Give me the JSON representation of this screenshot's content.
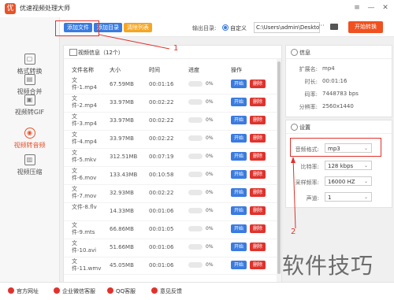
{
  "app": {
    "title": "优速视频处理大师",
    "logo_char": "优"
  },
  "window_controls": {
    "menu": "≡",
    "minimize": "—",
    "close": "✕"
  },
  "sidebar": {
    "items": [
      {
        "label": "格式转换",
        "icon": "convert-icon",
        "glyph": "▢"
      },
      {
        "label": "视频合并",
        "icon": "merge-icon",
        "glyph": "▤"
      },
      {
        "label": "视频转GIF",
        "icon": "gif-icon",
        "glyph": "▣"
      },
      {
        "label": "视频转音频",
        "icon": "audio-icon",
        "glyph": "◉"
      },
      {
        "label": "视频压缩",
        "icon": "compress-icon",
        "glyph": "▥"
      }
    ]
  },
  "toolbar": {
    "add_file": "添加文件",
    "add_folder": "添加目录",
    "clear_list": "清除列表",
    "output_label": "输出目录:",
    "custom_label": "自定义",
    "output_path": "C:\\Users\\admin\\Deskto",
    "dots": "···",
    "start": "开始转换"
  },
  "list": {
    "title": "视频信息（12个）",
    "headers": {
      "name": "文件名称",
      "size": "大小",
      "time": "时间",
      "progress": "进度",
      "action": "操作"
    },
    "start_label": "开始",
    "delete_label": "删除",
    "rows": [
      {
        "name": "文件-1.mp4",
        "size": "67.59MB",
        "time": "00:01:16",
        "progress": "0%"
      },
      {
        "name": "文件-2.mp4",
        "size": "33.97MB",
        "time": "00:02:22",
        "progress": "0%"
      },
      {
        "name": "文件-3.mp4",
        "size": "33.97MB",
        "time": "00:02:22",
        "progress": "0%"
      },
      {
        "name": "文件-4.mp4",
        "size": "33.97MB",
        "time": "00:02:22",
        "progress": "0%"
      },
      {
        "name": "文件-5.mkv",
        "size": "312.51MB",
        "time": "00:07:19",
        "progress": "0%"
      },
      {
        "name": "文件-6.mov",
        "size": "133.43MB",
        "time": "00:10:58",
        "progress": "0%"
      },
      {
        "name": "文件-7.mov",
        "size": "32.93MB",
        "time": "00:02:22",
        "progress": "0%"
      },
      {
        "name": "文件-8.flv",
        "size": "14.33MB",
        "time": "00:01:06",
        "progress": "0%"
      },
      {
        "name": "文件-9.mts",
        "size": "66.86MB",
        "time": "00:01:05",
        "progress": "0%"
      },
      {
        "name": "文件-10.avi",
        "size": "51.66MB",
        "time": "00:01:06",
        "progress": "0%"
      },
      {
        "name": "文件-11.wmv",
        "size": "45.05MB",
        "time": "00:01:06",
        "progress": "0%"
      }
    ]
  },
  "info": {
    "title": "信息",
    "fields": [
      {
        "label": "扩展名:",
        "value": "mp4"
      },
      {
        "label": "时长:",
        "value": "00:01:16"
      },
      {
        "label": "码率:",
        "value": "7448783 bps"
      },
      {
        "label": "分辨率:",
        "value": "2560x1440"
      }
    ]
  },
  "settings": {
    "title": "设置",
    "format_label": "音频格式:",
    "format_value": "mp3",
    "bitrate_label": "比特率:",
    "bitrate_value": "128 kbps",
    "samplerate_label": "采样频率:",
    "samplerate_value": "16000 HZ",
    "channels_label": "声道:",
    "channels_value": "1"
  },
  "bottom": {
    "website": "官方网址",
    "wechat": "企业微信客服",
    "qq": "QQ客服",
    "feedback": "意见反馈"
  },
  "annotations": {
    "marker1": "1",
    "marker2": "2"
  },
  "watermark": "软件技巧",
  "colors": {
    "accent": "#f0511f",
    "blue": "#3a7be0",
    "red": "#e0322c",
    "orange": "#f5a623"
  }
}
